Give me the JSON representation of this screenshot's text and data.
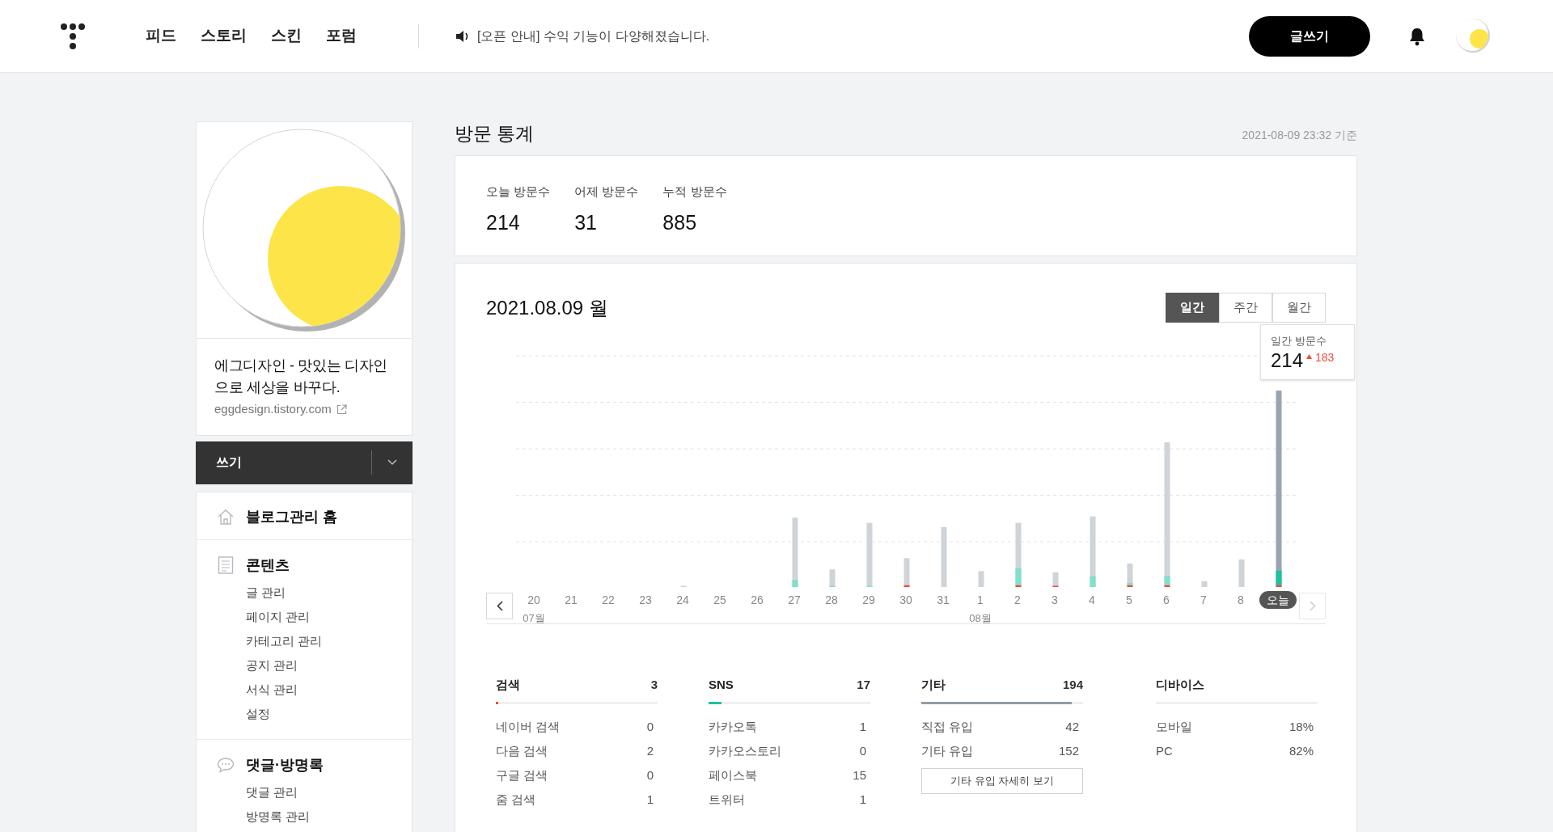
{
  "header": {
    "nav": [
      {
        "label": "피드"
      },
      {
        "label": "스토리"
      },
      {
        "label": "스킨"
      },
      {
        "label": "포럼"
      }
    ],
    "notice": "[오픈 안내] 수익 기능이 다양해졌습니다.",
    "write_button": "글쓰기"
  },
  "sidebar": {
    "blog_title": "에그디자인 - 맛있는 디자인으로 세상을 바꾸다.",
    "blog_url": "eggdesign.tistory.com",
    "write_button": "쓰기",
    "menu": [
      {
        "label": "블로그관리 홈",
        "kind": "home"
      },
      {
        "label": "콘텐츠",
        "kind": "document",
        "children": [
          {
            "label": "글 관리"
          },
          {
            "label": "페이지 관리"
          },
          {
            "label": "카테고리 관리"
          },
          {
            "label": "공지 관리"
          },
          {
            "label": "서식 관리"
          },
          {
            "label": "설정"
          }
        ]
      },
      {
        "label": "댓글·방명록",
        "kind": "comment",
        "children": [
          {
            "label": "댓글 관리"
          },
          {
            "label": "방명록 관리"
          }
        ]
      }
    ]
  },
  "page": {
    "title": "방문 통계",
    "as_of": "2021-08-09 23:32 기준"
  },
  "summary": [
    {
      "label": "오늘 방문수",
      "value": "214"
    },
    {
      "label": "어제 방문수",
      "value": "31"
    },
    {
      "label": "누적 방문수",
      "value": "885"
    }
  ],
  "chart": {
    "date": "2021.08.09 월",
    "tabs": [
      {
        "label": "일간",
        "selected": true
      },
      {
        "label": "주간",
        "selected": false
      },
      {
        "label": "월간",
        "selected": false
      }
    ],
    "tooltip": {
      "label": "일간 방문수",
      "value": "214",
      "change": "183"
    },
    "days": [
      {
        "label": "20",
        "month": "07월",
        "selected": false
      },
      {
        "label": "21",
        "selected": false
      },
      {
        "label": "22",
        "selected": false
      },
      {
        "label": "23",
        "selected": false
      },
      {
        "label": "24",
        "selected": false
      },
      {
        "label": "25",
        "selected": false
      },
      {
        "label": "26",
        "selected": false
      },
      {
        "label": "27",
        "selected": false
      },
      {
        "label": "28",
        "selected": false
      },
      {
        "label": "29",
        "selected": false
      },
      {
        "label": "30",
        "selected": false
      },
      {
        "label": "31",
        "selected": false
      },
      {
        "label": "1",
        "month": "08월",
        "selected": false
      },
      {
        "label": "2",
        "selected": false
      },
      {
        "label": "3",
        "selected": false
      },
      {
        "label": "4",
        "selected": false
      },
      {
        "label": "5",
        "selected": false
      },
      {
        "label": "6",
        "selected": false
      },
      {
        "label": "7",
        "selected": false
      },
      {
        "label": "8",
        "selected": false
      },
      {
        "label": "오늘",
        "selected": true
      }
    ]
  },
  "sources": [
    {
      "title": "검색",
      "total": "3",
      "level": 0.015,
      "color": "#f04b3c",
      "rows": [
        {
          "label": "네이버 검색",
          "value": "0"
        },
        {
          "label": "다음 검색",
          "value": "2"
        },
        {
          "label": "구글 검색",
          "value": "0"
        },
        {
          "label": "줌 검색",
          "value": "1"
        }
      ]
    },
    {
      "title": "SNS",
      "total": "17",
      "level": 0.08,
      "color": "#1bc3a0",
      "rows": [
        {
          "label": "카카오톡",
          "value": "1"
        },
        {
          "label": "카카오스토리",
          "value": "0"
        },
        {
          "label": "페이스북",
          "value": "15"
        },
        {
          "label": "트위터",
          "value": "1"
        }
      ]
    },
    {
      "title": "기타",
      "total": "194",
      "level": 0.93,
      "color": "#959ca8",
      "rows": [
        {
          "label": "직접 유입",
          "value": "42"
        },
        {
          "label": "기타 유입",
          "value": "152"
        }
      ],
      "button": "기타 유입 자세히 보기"
    },
    {
      "title": "디바이스",
      "rows": [
        {
          "label": "모바일",
          "value": "18%"
        },
        {
          "label": "PC",
          "value": "82%"
        }
      ]
    }
  ]
}
